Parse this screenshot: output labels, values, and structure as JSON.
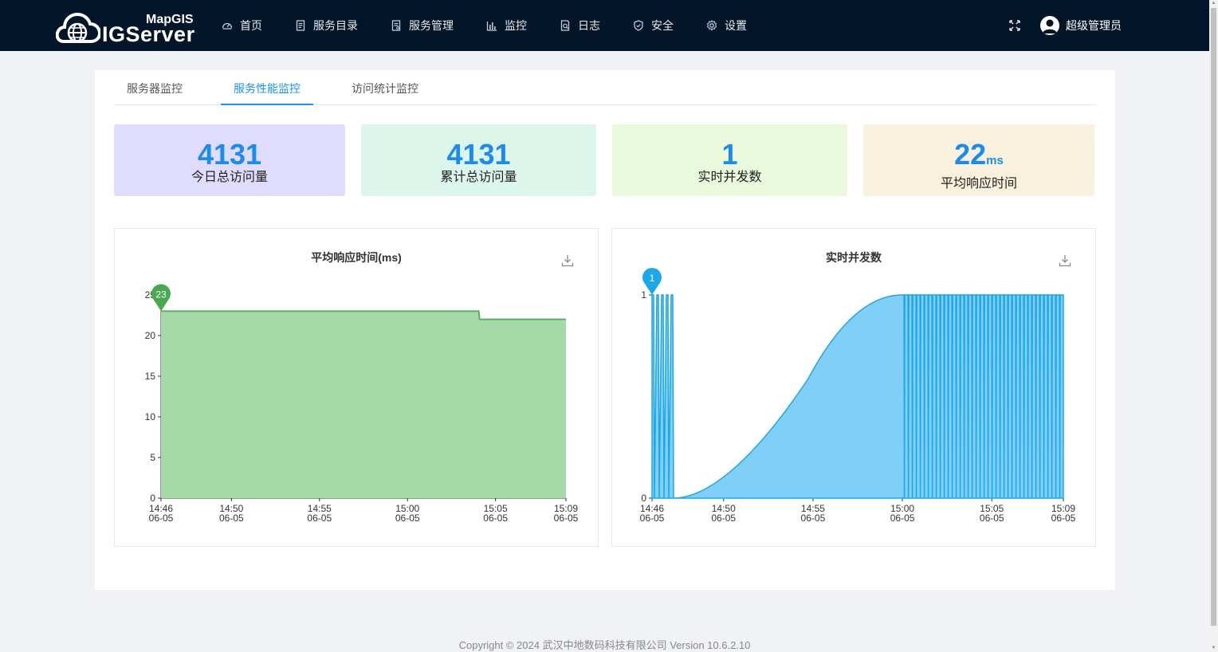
{
  "brand": {
    "top": "MapGIS",
    "bottom": "IGServer"
  },
  "nav": [
    {
      "label": "首页",
      "icon": "dashboard-icon"
    },
    {
      "label": "服务目录",
      "icon": "catalog-icon"
    },
    {
      "label": "服务管理",
      "icon": "manage-icon"
    },
    {
      "label": "监控",
      "icon": "bar-chart-icon"
    },
    {
      "label": "日志",
      "icon": "log-icon"
    },
    {
      "label": "安全",
      "icon": "shield-icon"
    },
    {
      "label": "设置",
      "icon": "gear-icon"
    }
  ],
  "user": {
    "name": "超级管理员"
  },
  "tabs": [
    {
      "label": "服务器监控",
      "active": false
    },
    {
      "label": "服务性能监控",
      "active": true
    },
    {
      "label": "访问统计监控",
      "active": false
    }
  ],
  "stats": [
    {
      "value": "4131",
      "unit": "",
      "caption": "今日总访问量",
      "bg": "#e0dcfd"
    },
    {
      "value": "4131",
      "unit": "",
      "caption": "累计总访问量",
      "bg": "#ddf6ec"
    },
    {
      "value": "1",
      "unit": "",
      "caption": "实时并发数",
      "bg": "#eaf8dc"
    },
    {
      "value": "22",
      "unit": "ms",
      "caption": "平均响应时间",
      "bg": "#f8f1dd"
    }
  ],
  "chart_data": [
    {
      "type": "area",
      "title": "平均响应时间(ms)",
      "color": "#5ab05e",
      "fill": "#a6d9a8",
      "ylim": [
        0,
        25
      ],
      "yticks": [
        "0",
        "5",
        "10",
        "15",
        "20",
        "25"
      ],
      "xticks": [
        {
          "time": "14:46",
          "date": "06-05"
        },
        {
          "time": "14:50",
          "date": "06-05"
        },
        {
          "time": "14:55",
          "date": "06-05"
        },
        {
          "time": "15:00",
          "date": "06-05"
        },
        {
          "time": "15:05",
          "date": "06-05"
        },
        {
          "time": "15:09",
          "date": "06-05"
        }
      ],
      "series": [
        {
          "x": [
            "14:46",
            "15:04",
            "15:04",
            "15:09"
          ],
          "y": [
            23,
            23,
            22,
            22
          ]
        }
      ],
      "marker": {
        "label": "23",
        "x": "14:46",
        "y": 23
      }
    },
    {
      "type": "area",
      "title": "实时并发数",
      "color": "#1ea7e8",
      "fill": "#80cff7",
      "ylim": [
        0,
        1
      ],
      "yticks": [
        "0",
        "1"
      ],
      "xticks": [
        {
          "time": "14:46",
          "date": "06-05"
        },
        {
          "time": "14:50",
          "date": "06-05"
        },
        {
          "time": "14:55",
          "date": "06-05"
        },
        {
          "time": "15:00",
          "date": "06-05"
        },
        {
          "time": "15:05",
          "date": "06-05"
        },
        {
          "time": "15:09",
          "date": "06-05"
        }
      ],
      "series": [
        {
          "x": [
            "14:46",
            "14:47",
            "14:47",
            "15:00",
            "15:00",
            "15:09"
          ],
          "y": [
            1,
            1,
            0,
            1,
            1,
            1
          ]
        }
      ],
      "marker": {
        "label": "1",
        "x": "14:46",
        "y": 1
      }
    }
  ],
  "footer": "Copyright © 2024 武汉中地数码科技有限公司 Version 10.6.2.10"
}
